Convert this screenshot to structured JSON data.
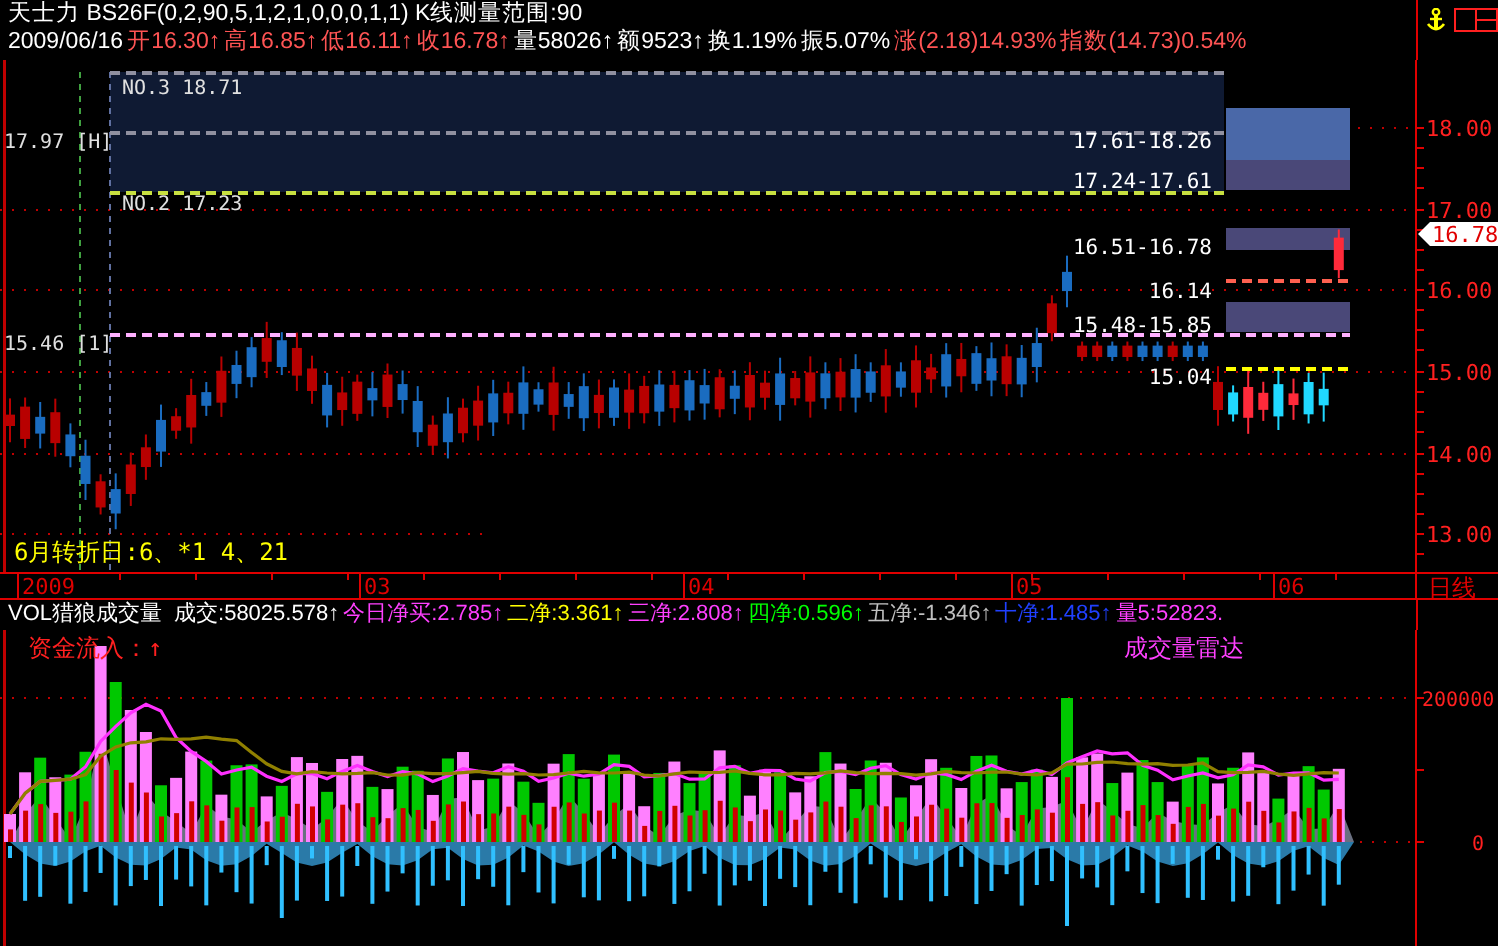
{
  "header": {
    "title": "天士力 BS26F(0,2,90,5,1,2,1,0,0,0,1,1) K线测量范围:90",
    "quote": [
      {
        "text": "2009/06/16",
        "color": "#ffffff"
      },
      {
        "text": "开16.30↑",
        "color": "#ff5454"
      },
      {
        "text": "高16.85↑",
        "color": "#ff5454"
      },
      {
        "text": "低16.11↑",
        "color": "#ff5454"
      },
      {
        "text": "收16.78↑",
        "color": "#ff5454"
      },
      {
        "text": "量58026↑",
        "color": "#ffffff"
      },
      {
        "text": "额9523↑",
        "color": "#ffffff"
      },
      {
        "text": "换1.19%",
        "color": "#ffffff"
      },
      {
        "text": "振5.07%",
        "color": "#ffffff"
      },
      {
        "text": "涨(2.18)14.93%",
        "color": "#ff5454"
      },
      {
        "text": "指数(14.73)0.54%",
        "color": "#ff5454"
      }
    ]
  },
  "price_chart": {
    "levels": [
      {
        "text": "NO.3 18.71",
        "color": "#9090a0"
      },
      {
        "text": "17.97 [H]",
        "color": "#9090a0"
      },
      {
        "text": "NO.2 17.23",
        "color": "#c8e040"
      },
      {
        "text": "15.46 [1]",
        "color": "#ffb0ff"
      }
    ],
    "zones": [
      {
        "kind": "band",
        "text": "17.61-18.26",
        "color": "#4a68a8"
      },
      {
        "kind": "band",
        "text": "17.24-17.61",
        "color": "#4a4878"
      },
      {
        "kind": "band",
        "text": "16.51-16.78",
        "color": "#4a4878"
      },
      {
        "kind": "line",
        "text": "16.14",
        "color": "#ff6050"
      },
      {
        "kind": "band",
        "text": "15.48-15.85",
        "color": "#4a4878"
      },
      {
        "kind": "line",
        "text": "15.04",
        "color": "#ffff00"
      }
    ],
    "note": "6月转折日:6、*1 4、21",
    "axis": [
      "18.00",
      "17.00",
      "16.00",
      "15.00",
      "14.00",
      "13.00"
    ],
    "last_price": "16.78"
  },
  "date_axis": {
    "labels": [
      "2009",
      "03",
      "04",
      "05",
      "06"
    ],
    "period": "日线"
  },
  "volume": {
    "title": "VOL猎狼成交量",
    "readings": [
      {
        "text": "成交:58025.578↑",
        "color": "#ffffff"
      },
      {
        "text": "今日净买:2.785↑",
        "color": "#ff40ff"
      },
      {
        "text": "二净:3.361↑",
        "color": "#ffff00"
      },
      {
        "text": "三净:2.808↑",
        "color": "#ff40ff"
      },
      {
        "text": "四净:0.596↑",
        "color": "#00ff00"
      },
      {
        "text": "五净:-1.346↑",
        "color": "#c0c0c0"
      },
      {
        "text": "十净:1.485↑",
        "color": "#2040ff"
      },
      {
        "text": "量5:52823.",
        "color": "#ff40ff"
      }
    ],
    "inflow": "资金流入：↑",
    "caption": "成交量雷达",
    "axis": [
      "200000",
      "0"
    ]
  }
}
